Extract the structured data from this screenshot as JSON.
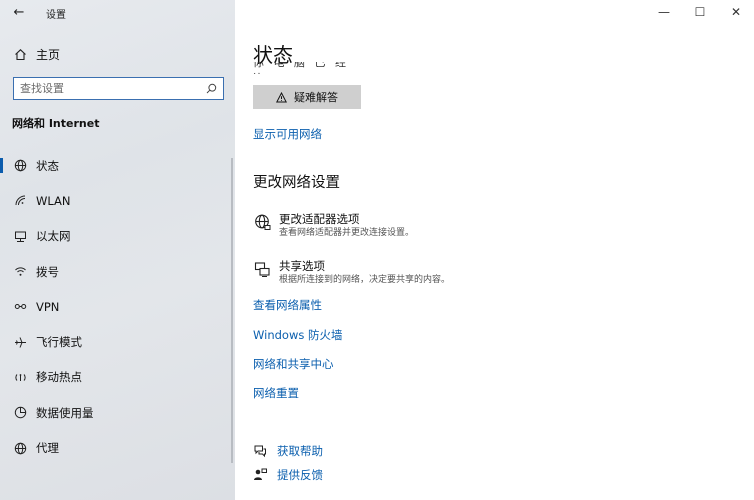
{
  "window": {
    "title": "设置",
    "back_symbol": "←",
    "minimize_symbol": "—",
    "maximize_symbol": "☐",
    "close_symbol": "✕"
  },
  "sidebar": {
    "home_label": "主页",
    "search_placeholder": "查找设置",
    "section_title": "网络和 Internet",
    "items": [
      {
        "label": "状态",
        "icon": "status-globe-icon",
        "active": true
      },
      {
        "label": "WLAN",
        "icon": "wifi-icon",
        "active": false
      },
      {
        "label": "以太网",
        "icon": "ethernet-icon",
        "active": false
      },
      {
        "label": "拨号",
        "icon": "dialup-icon",
        "active": false
      },
      {
        "label": "VPN",
        "icon": "vpn-icon",
        "active": false
      },
      {
        "label": "飞行模式",
        "icon": "airplane-icon",
        "active": false
      },
      {
        "label": "移动热点",
        "icon": "hotspot-icon",
        "active": false
      },
      {
        "label": "数据使用量",
        "icon": "data-usage-icon",
        "active": false
      },
      {
        "label": "代理",
        "icon": "proxy-globe-icon",
        "active": false
      }
    ]
  },
  "main": {
    "title": "状态",
    "clipped_text": "你 电 脑 已 经 连",
    "troubleshoot_label": "疑难解答",
    "show_networks_link": "显示可用网络",
    "change_heading": "更改网络设置",
    "adapter": {
      "title": "更改适配器选项",
      "desc": "查看网络适配器并更改连接设置。"
    },
    "sharing": {
      "title": "共享选项",
      "desc": "根据所连接到的网络，决定要共享的内容。"
    },
    "links": [
      "查看网络属性",
      "Windows 防火墙",
      "网络和共享中心",
      "网络重置"
    ],
    "help_label": "获取帮助",
    "feedback_label": "提供反馈"
  },
  "colors": {
    "accent": "#0b5cad",
    "link": "#0b5fae",
    "sidebar_bg": "#e3e6ea"
  }
}
